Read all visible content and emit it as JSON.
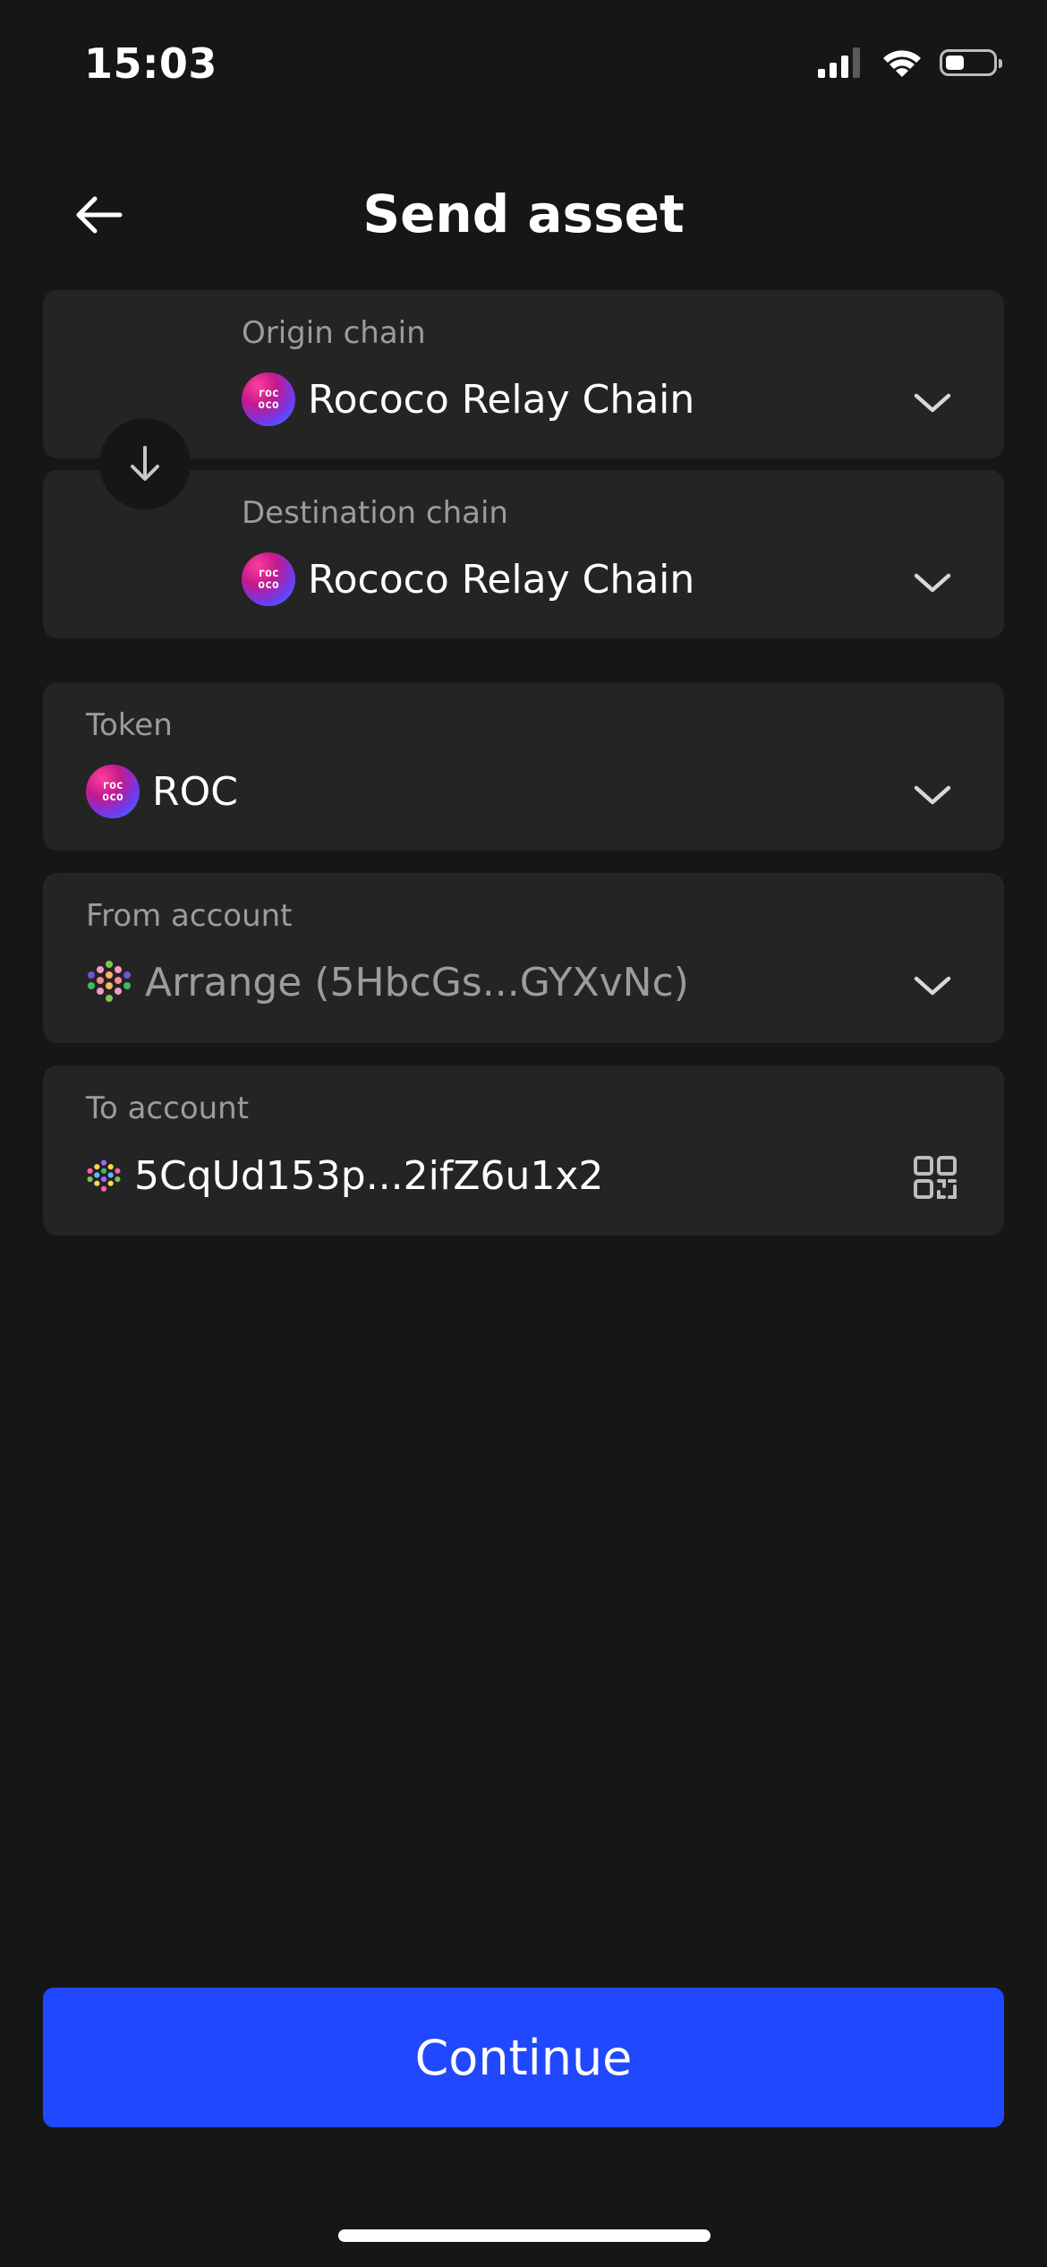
{
  "status_bar": {
    "time": "15:03",
    "battery_level": 0.4
  },
  "header": {
    "title": "Send asset",
    "back_icon": "arrow-left-icon"
  },
  "origin": {
    "label": "Origin chain",
    "value": "Rococo Relay Chain",
    "icon_text": [
      "roc",
      "oco"
    ]
  },
  "destination": {
    "label": "Destination chain",
    "value": "Rococo Relay Chain",
    "icon_text": [
      "roc",
      "oco"
    ]
  },
  "token": {
    "label": "Token",
    "value": "ROC",
    "icon_text": [
      "roc",
      "oco"
    ]
  },
  "from_account": {
    "label": "From account",
    "value": "Arrange (5HbcGs...GYXvNc)"
  },
  "to_account": {
    "label": "To account",
    "value": "5CqUd153p...2ifZ6u1x2",
    "qr_icon": "qr-code-icon"
  },
  "continue": {
    "label": "Continue"
  },
  "colors": {
    "background": "#161617",
    "card": "#242425",
    "accent": "#1f48ff",
    "muted_text": "#9c9c9e"
  }
}
